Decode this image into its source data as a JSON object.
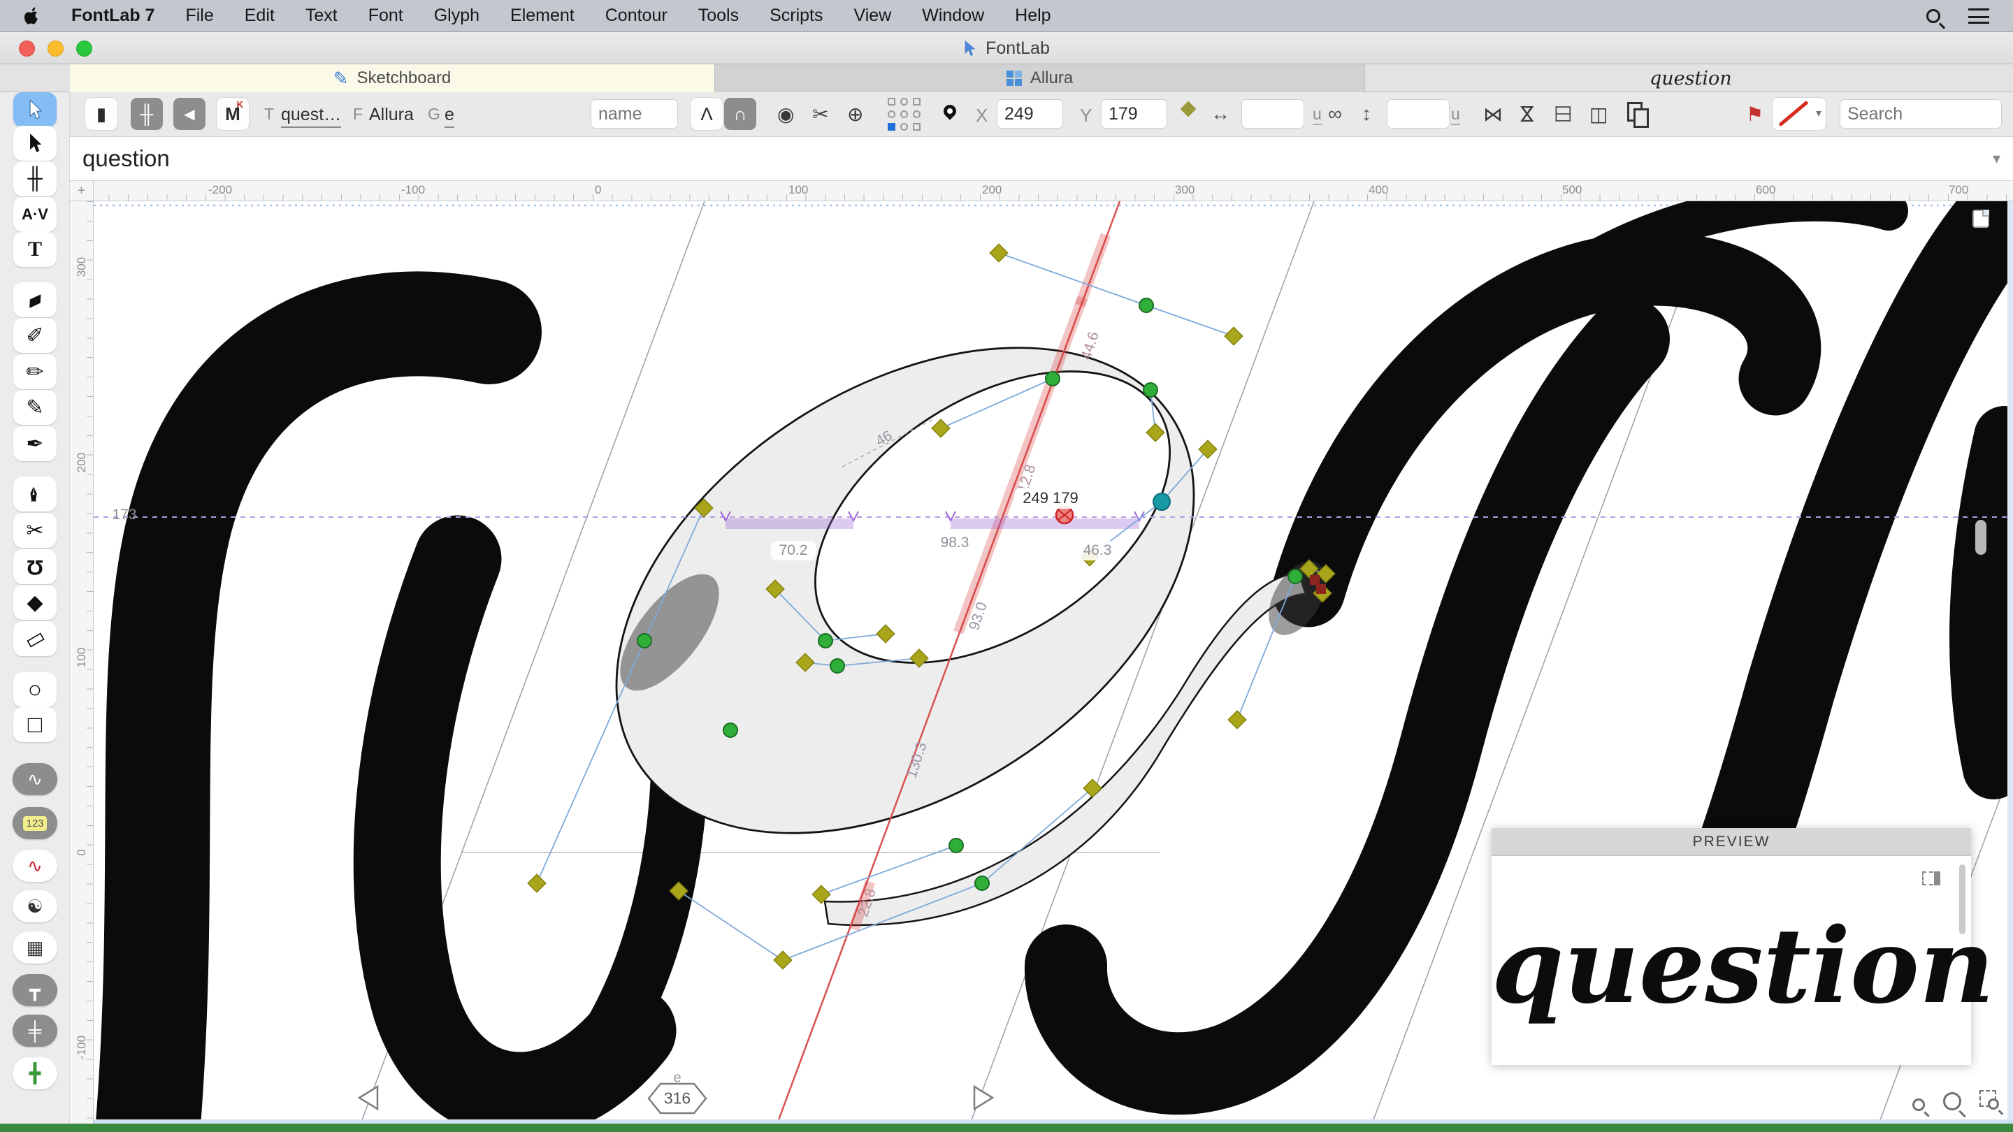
{
  "menu_bar": {
    "app": "FontLab 7",
    "items": [
      "File",
      "Edit",
      "Text",
      "Font",
      "Glyph",
      "Element",
      "Contour",
      "Tools",
      "Scripts",
      "View",
      "Window",
      "Help"
    ]
  },
  "window": {
    "title": "FontLab"
  },
  "tabs": {
    "sketchboard": "Sketchboard",
    "allura": "Allura",
    "preview_word": "question"
  },
  "toolbar": {
    "text_label": "T",
    "text_value": "quest…",
    "font_label": "F",
    "font_value": "Allura",
    "glyph_label": "G",
    "glyph_value": "e",
    "name_placeholder": "name",
    "x_label": "X",
    "x_value": "249",
    "y_label": "Y",
    "y_value": "179",
    "u_width": "u",
    "u_height": "u",
    "search_placeholder": "Search",
    "mode_m": "M",
    "mode_k": "K"
  },
  "text_bar": {
    "value": "question"
  },
  "ruler": {
    "h_ticks": [
      "-200",
      "-100",
      "0",
      "100",
      "200",
      "300",
      "400",
      "500",
      "600",
      "700"
    ],
    "v_ticks": [
      "300",
      "200",
      "100",
      "0",
      "-100"
    ],
    "xheight_label": "173"
  },
  "canvas": {
    "measurements": {
      "top_stem": "44.6",
      "inner_gap": "46",
      "mid_stem": "112.8",
      "node_coords": "249 179",
      "xh_span_mid": "98.3",
      "xh_span_left": "70.2",
      "xh_span_right": "46.3",
      "counter_width": "93.0",
      "bowl_width": "130.3",
      "bottom_stem": "22.8"
    },
    "glyph_letter": "e",
    "advance_width": "316"
  },
  "preview": {
    "title": "PREVIEW",
    "word": "question"
  },
  "icons": {
    "list": "☰",
    "sketchboard_pen": "✎",
    "panel": "▮",
    "metrics_small": "╫",
    "back": "◀",
    "sharp_node": "Λ",
    "smooth_node": "∩",
    "node_circle": "◉",
    "slice": "✂",
    "add_node": "⊕",
    "width_arrow": "↔",
    "height_arrow": "↕",
    "link": "∞",
    "flip_h": "⋈",
    "align_v": "◫",
    "flag": "⚑",
    "dropdown": "▾",
    "select_metrics_tool": "╫",
    "kerning_tool": "A·V",
    "text_tool": "T",
    "eraser_tool": "▰",
    "brush_tool": "✐",
    "pencil_tool": "✏",
    "rapid_tool": "✎",
    "pen_tool": "✒",
    "power_tool": "✒",
    "knife_tool": "✂",
    "magnet_tool": "Ω",
    "fill_tool": "◆",
    "ruler_tool": "▭",
    "ellipse_tool": "○",
    "rectangle_tool": "□",
    "toggle_curve": "∿",
    "toggle_numbers": "123",
    "toggle_nodes": "∿",
    "toggle_mask": "☯",
    "toggle_grid": "▦",
    "toggle_tsquare": "┳",
    "toggle_dashes": "╪",
    "toggle_cells": "╋"
  }
}
